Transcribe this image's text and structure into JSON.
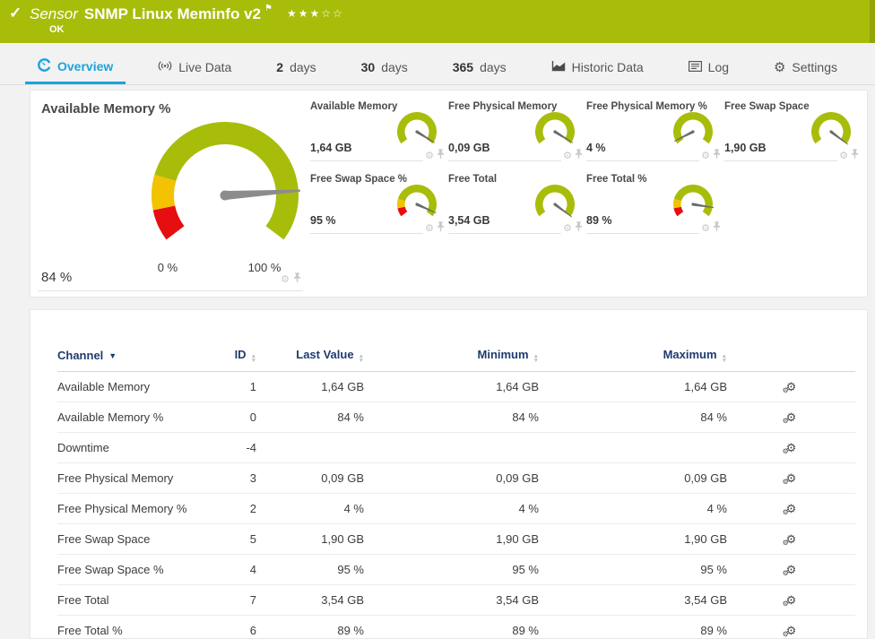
{
  "colors": {
    "brand_green": "#a8bd0a",
    "brand_green_dark": "#93a509",
    "gauge_green": "#a8bd0a",
    "gauge_yellow": "#f3c200",
    "gauge_red": "#e60e10",
    "accent_blue": "#1ba3dc",
    "table_header_navy": "#1e3c6f",
    "needle_gray": "#8c8c8c"
  },
  "header": {
    "kind": "Sensor",
    "title": "SNMP Linux Meminfo v2",
    "status": "OK",
    "stars_filled": 3,
    "stars_total": 5
  },
  "tabs": [
    {
      "slug": "overview",
      "label": "Overview",
      "icon": "gauge",
      "active": true
    },
    {
      "slug": "live-data",
      "label": "Live Data",
      "icon": "broadcast",
      "active": false
    },
    {
      "slug": "2-days",
      "num": "2",
      "label": "days",
      "active": false
    },
    {
      "slug": "30-days",
      "num": "30",
      "label": "days",
      "active": false
    },
    {
      "slug": "365-days",
      "num": "365",
      "label": "days",
      "active": false
    },
    {
      "slug": "historic-data",
      "label": "Historic Data",
      "icon": "chart",
      "active": false
    },
    {
      "slug": "log",
      "label": "Log",
      "icon": "log",
      "active": false
    },
    {
      "slug": "settings",
      "label": "Settings",
      "icon": "gear",
      "active": false
    }
  ],
  "gauge_panel": {
    "main_gauge": {
      "slug": "available-memory-pct",
      "title": "Available Memory %",
      "value": "84 %",
      "fraction": 0.84,
      "min_label": "0 %",
      "max_label": "100 %",
      "style": "thresholds"
    },
    "small_gauges": [
      {
        "slug": "available-memory",
        "title": "Available Memory",
        "value": "1,64 GB",
        "fraction": 0.98,
        "style": "plain"
      },
      {
        "slug": "free-physical-memory",
        "title": "Free Physical Memory",
        "value": "0,09 GB",
        "fraction": 0.98,
        "style": "plain"
      },
      {
        "slug": "free-physical-memory-pct",
        "title": "Free Physical Memory %",
        "value": "4 %",
        "fraction": 0.04,
        "style": "plain"
      },
      {
        "slug": "free-swap-space",
        "title": "Free Swap Space",
        "value": "1,90 GB",
        "fraction": 1.0,
        "style": "plain"
      },
      {
        "slug": "free-swap-space-pct",
        "title": "Free Swap Space %",
        "value": "95 %",
        "fraction": 0.95,
        "style": "thresholds"
      },
      {
        "slug": "free-total",
        "title": "Free Total",
        "value": "3,54 GB",
        "fraction": 1.0,
        "style": "plain"
      },
      {
        "slug": "free-total-pct",
        "title": "Free Total %",
        "value": "89 %",
        "fraction": 0.89,
        "style": "thresholds"
      }
    ]
  },
  "table": {
    "columns": [
      {
        "label": "Channel",
        "sorted": true
      },
      {
        "label": "ID",
        "sorted": false
      },
      {
        "label": "Last Value",
        "sorted": false
      },
      {
        "label": "Minimum",
        "sorted": false
      },
      {
        "label": "Maximum",
        "sorted": false
      }
    ],
    "rows": [
      {
        "channel": "Available Memory",
        "id": "1",
        "last": "1,64 GB",
        "min": "1,64 GB",
        "max": "1,64 GB"
      },
      {
        "channel": "Available Memory %",
        "id": "0",
        "last": "84 %",
        "min": "84 %",
        "max": "84 %"
      },
      {
        "channel": "Downtime",
        "id": "-4",
        "last": "",
        "min": "",
        "max": ""
      },
      {
        "channel": "Free Physical Memory",
        "id": "3",
        "last": "0,09 GB",
        "min": "0,09 GB",
        "max": "0,09 GB"
      },
      {
        "channel": "Free Physical Memory %",
        "id": "2",
        "last": "4 %",
        "min": "4 %",
        "max": "4 %"
      },
      {
        "channel": "Free Swap Space",
        "id": "5",
        "last": "1,90 GB",
        "min": "1,90 GB",
        "max": "1,90 GB"
      },
      {
        "channel": "Free Swap Space %",
        "id": "4",
        "last": "95 %",
        "min": "95 %",
        "max": "95 %"
      },
      {
        "channel": "Free Total",
        "id": "7",
        "last": "3,54 GB",
        "min": "3,54 GB",
        "max": "3,54 GB"
      },
      {
        "channel": "Free Total %",
        "id": "6",
        "last": "89 %",
        "min": "89 %",
        "max": "89 %"
      }
    ]
  }
}
